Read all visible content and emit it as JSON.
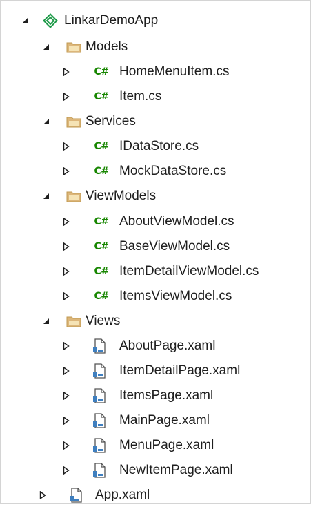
{
  "colors": {
    "csharp_accent": "#178600",
    "folder_fill": "#dcb67a",
    "project_icon": "#1f9b4a",
    "text": "#1e1e1e",
    "xaml_blue": "#3f7fbf"
  },
  "tree": {
    "project": {
      "label": "LinkarDemoApp",
      "icon": "xamarin-project-icon",
      "expanded": true
    },
    "folders": [
      {
        "label": "Models",
        "icon": "folder-icon",
        "expanded": true,
        "files": [
          {
            "label": "HomeMenuItem.cs",
            "icon": "csharp-file-icon",
            "icon_text": "C#"
          },
          {
            "label": "Item.cs",
            "icon": "csharp-file-icon",
            "icon_text": "C#"
          }
        ]
      },
      {
        "label": "Services",
        "icon": "folder-icon",
        "expanded": true,
        "files": [
          {
            "label": "IDataStore.cs",
            "icon": "csharp-file-icon",
            "icon_text": "C#"
          },
          {
            "label": "MockDataStore.cs",
            "icon": "csharp-file-icon",
            "icon_text": "C#"
          }
        ]
      },
      {
        "label": "ViewModels",
        "icon": "folder-icon",
        "expanded": true,
        "files": [
          {
            "label": "AboutViewModel.cs",
            "icon": "csharp-file-icon",
            "icon_text": "C#"
          },
          {
            "label": "BaseViewModel.cs",
            "icon": "csharp-file-icon",
            "icon_text": "C#"
          },
          {
            "label": "ItemDetailViewModel.cs",
            "icon": "csharp-file-icon",
            "icon_text": "C#"
          },
          {
            "label": "ItemsViewModel.cs",
            "icon": "csharp-file-icon",
            "icon_text": "C#"
          }
        ]
      },
      {
        "label": "Views",
        "icon": "folder-icon",
        "expanded": true,
        "files": [
          {
            "label": "AboutPage.xaml",
            "icon": "xaml-file-icon"
          },
          {
            "label": "ItemDetailPage.xaml",
            "icon": "xaml-file-icon"
          },
          {
            "label": "ItemsPage.xaml",
            "icon": "xaml-file-icon"
          },
          {
            "label": "MainPage.xaml",
            "icon": "xaml-file-icon"
          },
          {
            "label": "MenuPage.xaml",
            "icon": "xaml-file-icon"
          },
          {
            "label": "NewItemPage.xaml",
            "icon": "xaml-file-icon"
          }
        ]
      }
    ],
    "root_files": [
      {
        "label": "App.xaml",
        "icon": "xaml-file-icon"
      }
    ]
  }
}
